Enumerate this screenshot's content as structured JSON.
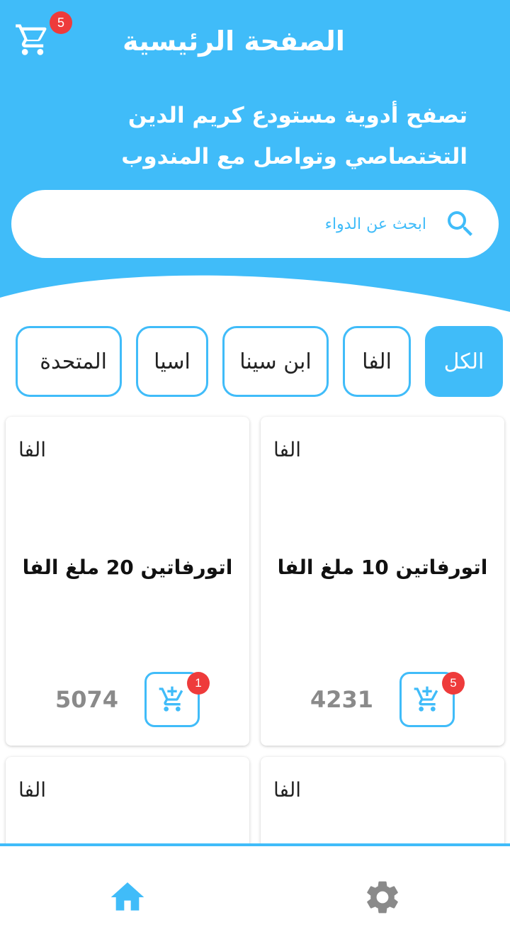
{
  "header": {
    "title": "الصفحة الرئيسية",
    "subtitle": "تصفح أدوية مستودع كريم الدين التختصاصي وتواصل مع المندوب",
    "cart_icon": "cart-icon",
    "cart_count": "5"
  },
  "search": {
    "placeholder": "ابحث عن الدواء",
    "icon": "search-icon"
  },
  "filters": [
    {
      "label": "الكل",
      "active": true
    },
    {
      "label": "الفا",
      "active": false
    },
    {
      "label": "ابن سينا",
      "active": false
    },
    {
      "label": "اسيا",
      "active": false
    },
    {
      "label": "المتحدة",
      "active": false
    }
  ],
  "products": [
    {
      "company": "الفا",
      "name": "اتورفاتين 10 ملغ الفا",
      "price": "4231",
      "cart_count": "5"
    },
    {
      "company": "الفا",
      "name": "اتورفاتين 20 ملغ الفا",
      "price": "5074",
      "cart_count": "1"
    },
    {
      "company": "الفا"
    },
    {
      "company": "الفا"
    }
  ],
  "bottom_nav": {
    "home_icon": "home-icon",
    "settings_icon": "gear-icon"
  },
  "colors": {
    "accent": "#40bcf9",
    "badge": "#ee3b3b",
    "price": "#8a8a8a",
    "nav_inactive": "#8a8a8a"
  }
}
